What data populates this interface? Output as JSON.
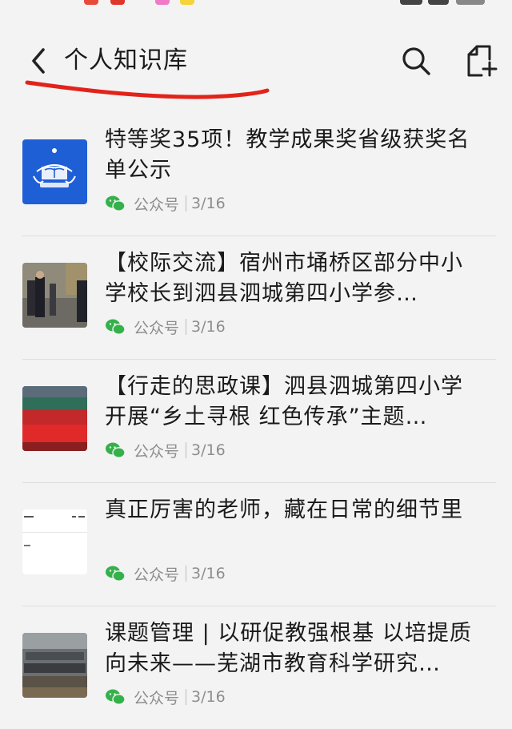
{
  "header": {
    "title": "个人知识库"
  },
  "icons": {
    "back": "chevron-left-icon",
    "search": "search-icon",
    "new_document": "new-document-icon",
    "source": "wechat-icon"
  },
  "colors": {
    "background": "#f3f3f3",
    "annotation_red": "#e2231a",
    "wechat_green": "#34b14a",
    "meta_text": "#8d8d8d"
  },
  "articles": [
    {
      "title": "特等奖35项！教学成果奖省级获奖名单公示",
      "source": "公众号",
      "date": "3/16"
    },
    {
      "title": "【校际交流】宿州市埇桥区部分中小学校长到泗县泗城第四小学参…",
      "source": "公众号",
      "date": "3/16"
    },
    {
      "title": "【行走的思政课】泗县泗城第四小学开展“乡土寻根 红色传承”主题…",
      "source": "公众号",
      "date": "3/16"
    },
    {
      "title": "真正厉害的老师，藏在日常的细节里",
      "source": "公众号",
      "date": "3/16"
    },
    {
      "title": "课题管理 | 以研促教强根基 以培提质向未来——芜湖市教育科学研究…",
      "source": "公众号",
      "date": "3/16"
    }
  ]
}
